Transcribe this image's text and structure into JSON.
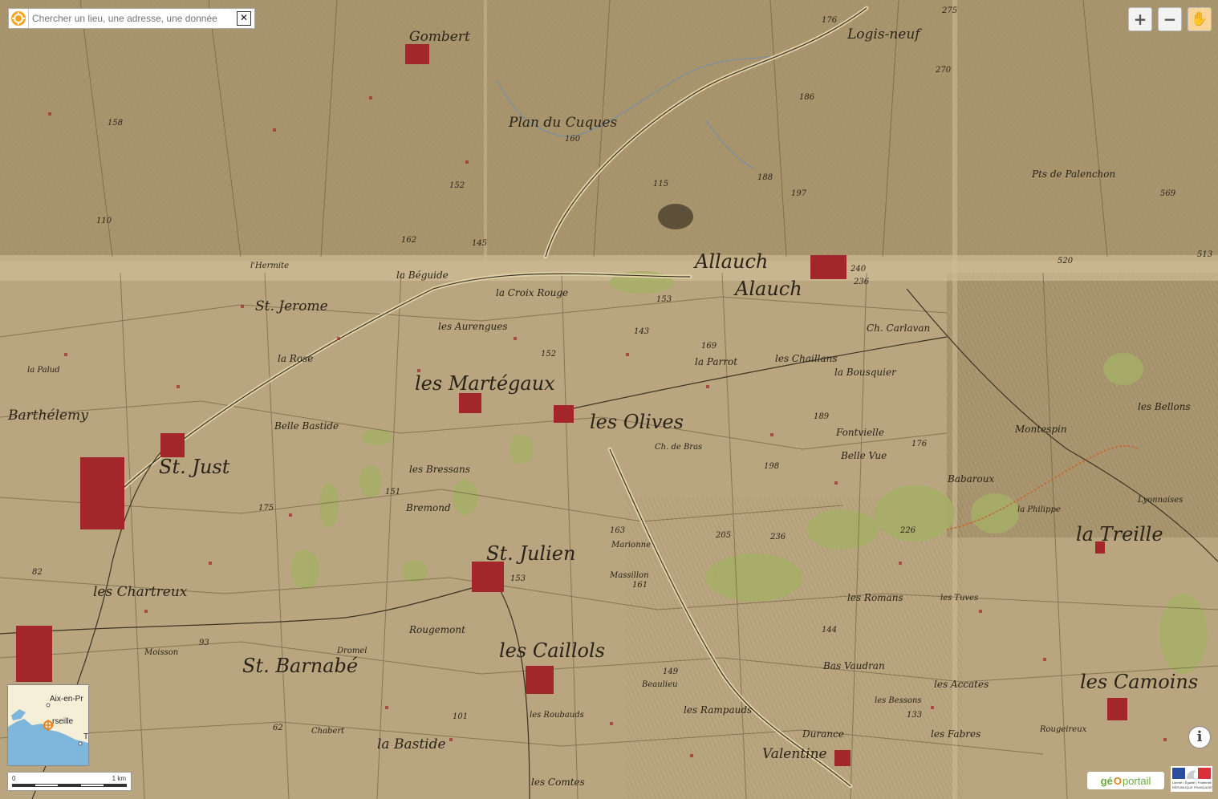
{
  "search": {
    "placeholder": "Chercher un lieu, une adresse, une donnée",
    "clear_glyph": "✕"
  },
  "controls": {
    "zoom_in_glyph": "+",
    "zoom_out_glyph": "−",
    "hand_glyph": "✋"
  },
  "map": {
    "places_large": [
      "Allauch",
      "Alauch",
      "les Martégaux",
      "les Olives",
      "St. Julien",
      "les Caillols",
      "les Camoins",
      "St. Just",
      "St. Jerome",
      "St. Barnabé",
      "les Chartreux",
      "la Treille",
      "Gombert",
      "Logis-neuf",
      "Valentine"
    ],
    "places_medium": [
      "Plan du Cuques",
      "la Béguide",
      "la Croix Rouge",
      "les Aurengues",
      "Barthélemy",
      "la Rose",
      "Belle Bastide",
      "Fontvielle",
      "Belle Vue",
      "Babaroux",
      "Montespin",
      "les Romans",
      "Bas Vaudran",
      "les Rampauds",
      "la Bastide",
      "les Bressans",
      "Bremond",
      "Rougemont",
      "Pts de Palenchon",
      "la Parrot",
      "les Chaillans",
      "la Bousquier",
      "Ch. Carlavan"
    ],
    "places_small": [
      "Ch. de Bras",
      "les Bellons",
      "Marionne",
      "Massillon",
      "les Fabres",
      "les Accates",
      "les Tuves",
      "l'Hermite",
      "les Bessons",
      "les Roubauds",
      "Durance",
      "la Philippe",
      "Lyonnaises",
      "Dromel",
      "Chabert",
      "Beaulieu",
      "la Palud",
      "Rougeireux",
      "Moisson",
      "les Comtes"
    ],
    "altitudes": [
      "176",
      "275",
      "270",
      "186",
      "160",
      "188",
      "197",
      "115",
      "569",
      "520",
      "513",
      "240",
      "236",
      "169",
      "189",
      "176",
      "198",
      "205",
      "226",
      "236",
      "153",
      "163",
      "151",
      "175",
      "162",
      "153",
      "145",
      "101",
      "62",
      "82",
      "93",
      "110",
      "152",
      "158",
      "152",
      "143",
      "161",
      "144",
      "149",
      "133"
    ]
  },
  "overview_map": {
    "label_aix": "Aix-en-Pr",
    "label_marseille": "rseille",
    "label_t": "T"
  },
  "scale": {
    "zero": "0",
    "one_km": "1 km"
  },
  "info_button": {
    "glyph": "i"
  },
  "logos": {
    "geoportail_ge": "gé",
    "geoportail_o": "O",
    "geoportail_portail": "portail",
    "republique_text": "Liberté • Égalité • Fraternité",
    "republique_subtext": "RÉPUBLIQUE FRANÇAISE"
  },
  "colors": {
    "parchment": "#b8a47e",
    "village_red": "#a3262b",
    "meadow_green": "#a6b066",
    "road_tan": "#d9c79e",
    "water_blue": "#6d8fb2",
    "geoportail_orange": "#e8801c",
    "geoportail_green": "#6ca83b"
  }
}
